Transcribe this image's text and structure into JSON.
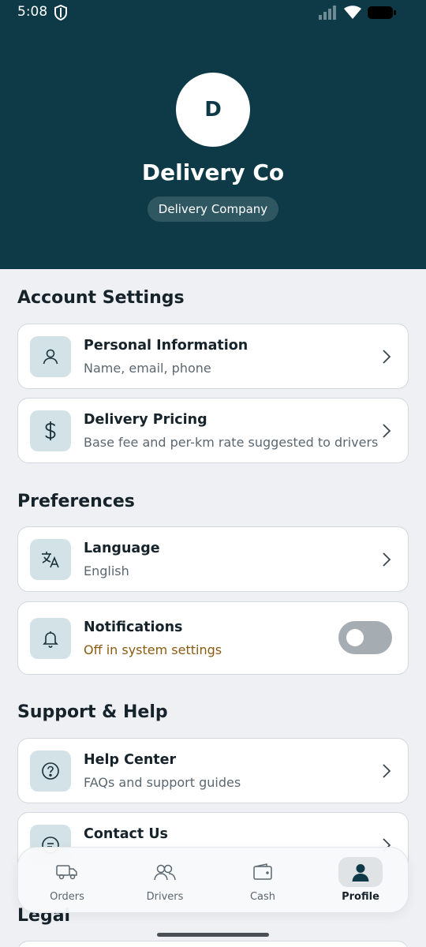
{
  "status_bar": {
    "time": "5:08"
  },
  "profile": {
    "avatar_letter": "D",
    "name": "Delivery Co",
    "role": "Delivery Company"
  },
  "sections": {
    "account": {
      "title": "Account Settings",
      "items": [
        {
          "title": "Personal Information",
          "subtitle": "Name, email, phone",
          "icon": "user-icon"
        },
        {
          "title": "Delivery Pricing",
          "subtitle": "Base fee and per-km rate suggested to drivers",
          "icon": "dollar-icon"
        }
      ]
    },
    "preferences": {
      "title": "Preferences",
      "items": [
        {
          "title": "Language",
          "subtitle": "English",
          "icon": "translate-icon"
        },
        {
          "title": "Notifications",
          "subtitle": "Off in system settings",
          "icon": "bell-icon",
          "toggle_on": false
        }
      ]
    },
    "support": {
      "title": "Support & Help",
      "items": [
        {
          "title": "Help Center",
          "subtitle": "FAQs and support guides",
          "icon": "question-icon"
        },
        {
          "title": "Contact Us",
          "subtitle": "",
          "icon": "chat-icon"
        }
      ]
    },
    "legal": {
      "title": "Legal"
    }
  },
  "nav": {
    "items": [
      {
        "label": "Orders",
        "icon": "truck-icon"
      },
      {
        "label": "Drivers",
        "icon": "users-icon"
      },
      {
        "label": "Cash",
        "icon": "wallet-icon"
      },
      {
        "label": "Profile",
        "icon": "person-icon",
        "active": true
      }
    ]
  },
  "colors": {
    "header_bg": "#0e3a47",
    "page_bg": "#eef0f3",
    "icon_tile_bg": "#d3e2e6",
    "warning_text": "#8a5a10",
    "toggle_off": "#a5adb3"
  }
}
